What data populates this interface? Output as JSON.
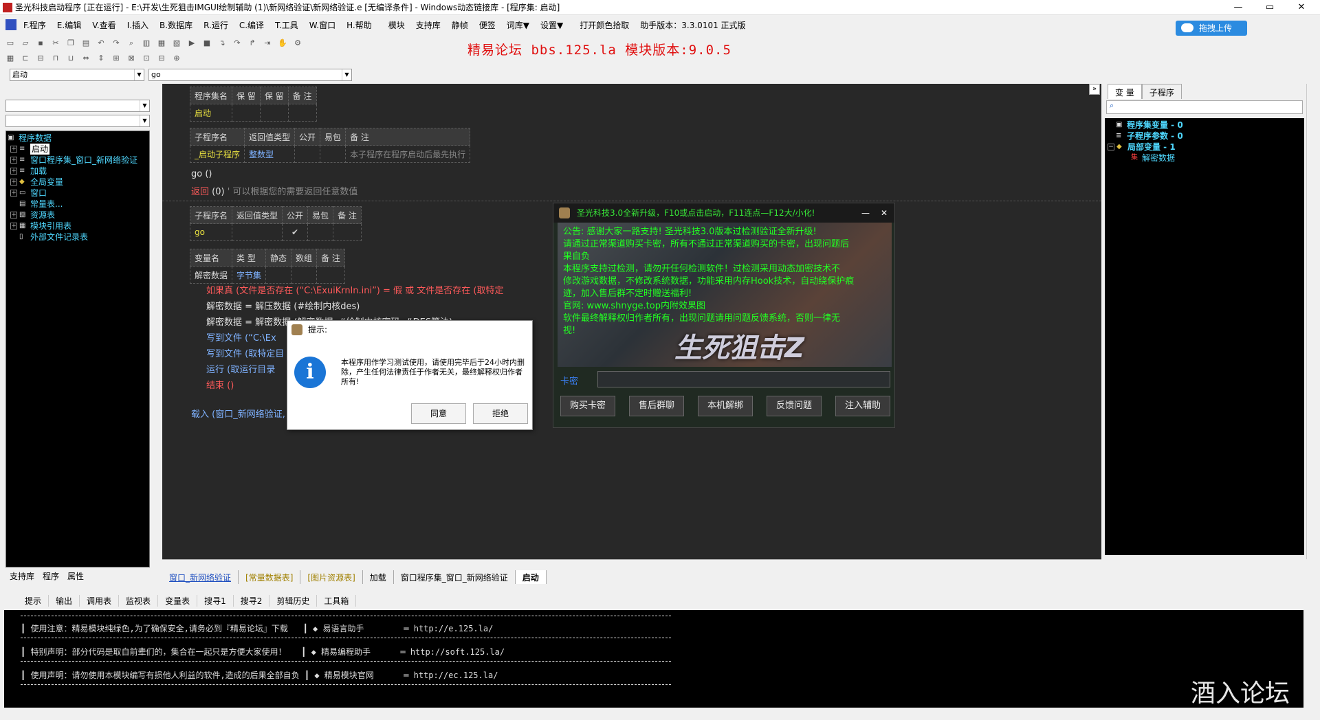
{
  "window": {
    "title": "圣光科技启动程序 [正在运行] - E:\\开发\\生死狙击IMGUI绘制辅助 (1)\\新网络验证\\新网络验证.e [无编译条件] - Windows动态链接库 - [程序集: 启动]",
    "minimize": "—",
    "maximize": "▭",
    "close": "✕"
  },
  "menu": [
    "F.程序",
    "E.编辑",
    "V.查看",
    "I.插入",
    "B.数据库",
    "R.运行",
    "C.编译",
    "T.工具",
    "W.窗口",
    "H.帮助",
    "模块",
    "支持库",
    "静帧",
    "便签",
    "词库▼",
    "设置▼",
    "打开颜色拾取",
    "助手版本：3.3.0101 正式版"
  ],
  "banner": "精易论坛 bbs.125.la 模块版本:9.0.5",
  "upload_label": "拖拽上传",
  "combos": {
    "left": "启动",
    "right": "go"
  },
  "left_tree": {
    "root": "程序数据",
    "items": [
      "启动",
      "窗口程序集_窗口_新网络验证",
      "加载",
      "全局变量",
      "窗口",
      "常量表...",
      "资源表",
      "模块引用表",
      "外部文件记录表"
    ]
  },
  "left_tabs": [
    "支持库",
    "程序",
    "属性"
  ],
  "editor": {
    "t1": {
      "headers": [
        "程序集名",
        "保 留",
        "保 留",
        "备 注"
      ],
      "row": [
        "启动",
        "",
        "",
        ""
      ]
    },
    "t2": {
      "headers": [
        "子程序名",
        "返回值类型",
        "公开",
        "易包",
        "备 注"
      ],
      "row": [
        "_启动子程序",
        "整数型",
        "",
        "",
        "本子程序在程序启动后最先执行"
      ]
    },
    "line_go": "go ()",
    "line_ret_kw": "返回",
    "line_ret_val": "(0)",
    "line_ret_cm": "' 可以根据您的需要返回任意数值",
    "t3": {
      "headers": [
        "子程序名",
        "返回值类型",
        "公开",
        "易包",
        "备 注"
      ],
      "row": [
        "go",
        "",
        "✔",
        "",
        ""
      ]
    },
    "t4": {
      "headers": [
        "变量名",
        "类 型",
        "静态",
        "数组",
        "备 注"
      ],
      "row": [
        "解密数据",
        "字节集",
        "",
        "",
        ""
      ]
    },
    "code": [
      "如果真 (文件是否存在 (“C:\\ExuiKrnln.ini”) = 假 或 文件是否存在 (取特定",
      "解密数据 = 解压数据 (#绘制内核des)",
      "解密数据 = 解密数据 (解密数据, #绘制内核密码, #DES算法)",
      "写到文件 (“C:\\Ex",
      "写到文件 (取特定目",
      "运行 (取运行目录",
      "结束 ()",
      "载入 (窗口_新网络验证, , 假)"
    ]
  },
  "doc_tabs": [
    "窗口_新网络验证",
    "[常量数据表]",
    "[图片资源表]",
    "加载",
    "窗口程序集_窗口_新网络验证",
    "启动"
  ],
  "right_pane": {
    "tabs": [
      "变 量",
      "子程序"
    ],
    "search_icon": "⌕",
    "tree": [
      "程序集变量 - 0",
      "子程序参数 - 0",
      "局部变量 - 1",
      "解密数据"
    ]
  },
  "game_dialog": {
    "title": "圣光科技3.0全新升级，F10或点击启动，F11连点—F12大/小化!",
    "lines": [
      "公告: 感谢大家一路支持! 圣光科技3.0版本过检测验证全新升级!",
      "请通过正常渠道购买卡密，所有不通过正常渠道购买的卡密，出现问题后",
      "果自负",
      "本程序支持过检测，请勿开任何检测软件！过检测采用动态加密技术不",
      "修改游戏数据，不修改系统数据，功能采用内存Hook技术，自动绕保护痕",
      "迹，加入售后群不定时赠送福利!",
      "官网: www.shnyge.top内附效果图",
      "软件最终解释权归作者所有，出现问题请用问题反馈系统，否则一律无",
      "视!"
    ],
    "brand": "生死狙击Z",
    "card_label": "卡密",
    "buttons": [
      "购买卡密",
      "售后群聊",
      "本机解绑",
      "反馈问题",
      "注入辅助"
    ],
    "min": "—",
    "close": "✕"
  },
  "msgbox": {
    "title": "提示:",
    "text": "本程序用作学习测试使用，请使用完毕后于24小时内删除，产生任何法律责任于作者无关，最终解释权归作者所有!",
    "ok": "同意",
    "reject": "拒绝"
  },
  "output_tabs": [
    "提示",
    "输出",
    "调用表",
    "监视表",
    "变量表",
    "搜寻1",
    "搜寻2",
    "剪辑历史",
    "工具箱"
  ],
  "output_lines": [
    "┃ 使用注意：精易模块纯绿色,为了确保安全,请务必到『精易论坛』下载   ┃ ◆ 易语言助手        ═ http://e.125.la/",
    "┃ 特别声明：部分代码是取自前辈们的，集合在一起只是方便大家使用！   ┃ ◆ 精易编程助手      ═ http://soft.125.la/",
    "┃ 使用声明：请勿使用本模块编写有损他人利益的软件,造成的后果全部自负 ┃ ◆ 精易模块官网      ═ http://ec.125.la/"
  ],
  "watermark": "酒入论坛"
}
